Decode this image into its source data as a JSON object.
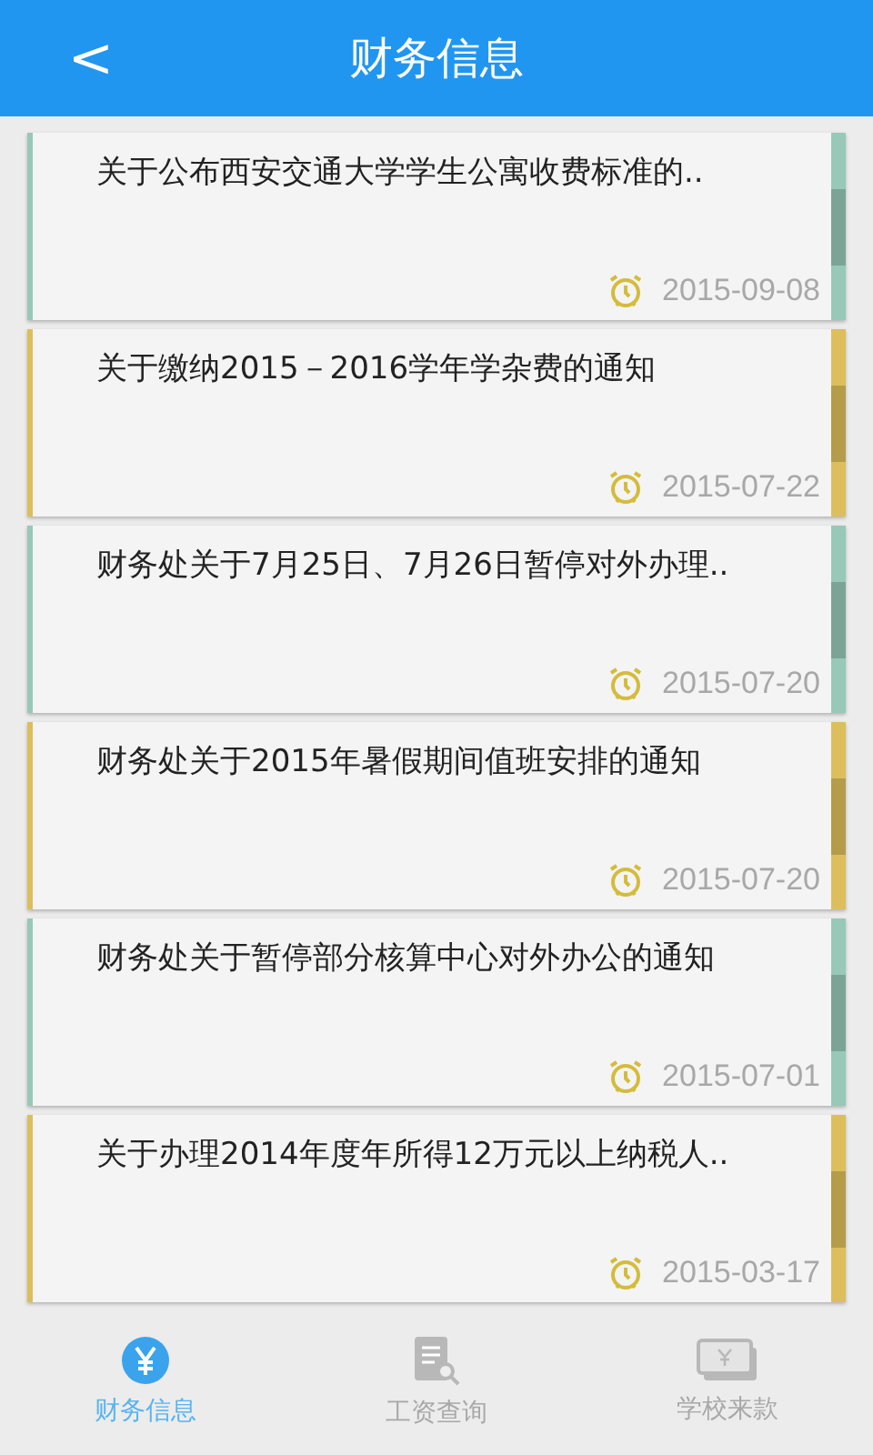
{
  "header": {
    "back": "<",
    "title": "财务信息"
  },
  "notices": [
    {
      "title": "关于公布西安交通大学学生公寓收费标准的..",
      "date": "2015-09-08",
      "color": "#97c8b8"
    },
    {
      "title": "关于缴纳2015－2016学年学杂费的通知",
      "date": "2015-07-22",
      "color": "#dcbf5c"
    },
    {
      "title": "财务处关于7月25日、7月26日暂停对外办理..",
      "date": "2015-07-20",
      "color": "#97c8b8"
    },
    {
      "title": "财务处关于2015年暑假期间值班安排的通知",
      "date": "2015-07-20",
      "color": "#dcbf5c"
    },
    {
      "title": "财务处关于暂停部分核算中心对外办公的通知",
      "date": "2015-07-01",
      "color": "#97c8b8"
    },
    {
      "title": "关于办理2014年度年所得12万元以上纳税人..",
      "date": "2015-03-17",
      "color": "#dcbf5c"
    }
  ],
  "tabs": [
    {
      "label": "财务信息",
      "kind": "yen",
      "selected": true
    },
    {
      "label": "工资查询",
      "kind": "doc",
      "selected": false
    },
    {
      "label": "学校来款",
      "kind": "money",
      "selected": false
    }
  ]
}
